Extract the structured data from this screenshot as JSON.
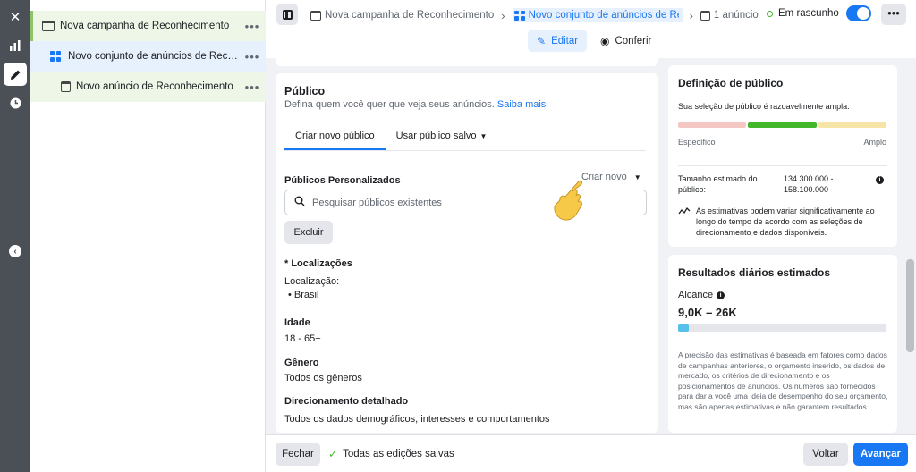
{
  "tree": {
    "campaign": "Nova campanha de Reconhecimento",
    "adset": "Novo conjunto de anúncios de Reconhecimento",
    "ad": "Novo anúncio de Reconhecimento",
    "more": "•••"
  },
  "breadcrumb": {
    "campaign": "Nova campanha de Reconhecimento",
    "adset": "Novo conjunto de anúncios de Reconhecimento",
    "ads": "1 anúncio"
  },
  "status": {
    "label": "Em rascunho",
    "toggle_on": true
  },
  "mode": {
    "edit": "Editar",
    "review": "Conferir"
  },
  "audience": {
    "title": "Público",
    "description": "Defina quem você quer que veja seus anúncios.",
    "learn_more": "Saiba mais",
    "tabs": [
      "Criar novo público",
      "Usar público salvo"
    ],
    "custom_audiences_label": "Públicos Personalizados",
    "create_new": "Criar novo",
    "search_placeholder": "Pesquisar públicos existentes",
    "exclude": "Excluir",
    "locations_label": "* Localizações",
    "location_sublabel": "Localização:",
    "location_value": "• Brasil",
    "age_label": "Idade",
    "age_value": "18 - 65+",
    "gender_label": "Gênero",
    "gender_value": "Todos os gêneros",
    "targeting_label": "Direcionamento detalhado",
    "targeting_value": "Todos os dados demográficos, interesses e comportamentos"
  },
  "definition": {
    "title": "Definição de público",
    "subtitle": "Sua seleção de público é razoavelmente ampla.",
    "scale_left": "Específico",
    "scale_right": "Amplo",
    "size_label": "Tamanho estimado do público:",
    "size_value": "134.300.000 - 158.100.000",
    "note": "As estimativas podem variar significativamente ao longo do tempo de acordo com as seleções de direcionamento e dados disponíveis.",
    "colors": {
      "specific": "#f5c7c4",
      "ideal": "#42b72a",
      "broad": "#f7e4a8"
    }
  },
  "results": {
    "title": "Resultados diários estimados",
    "reach_label": "Alcance",
    "reach_value": "9,0K – 26K",
    "reach_fill_fraction": 0.05,
    "disclaimer": "A precisão das estimativas é baseada em fatores como dados de campanhas anteriores, o orçamento inserido, os dados de mercado, os critérios de direcionamento e os posicionamentos de anúncios. Os números são fornecidos para dar a você uma ideia de desempenho do seu orçamento, mas são apenas estimativas e não garantem resultados."
  },
  "footer": {
    "close": "Fechar",
    "saved": "Todas as edições salvas",
    "back": "Voltar",
    "next": "Avançar"
  },
  "colors": {
    "accent": "#1877f2",
    "success": "#42b72a"
  }
}
